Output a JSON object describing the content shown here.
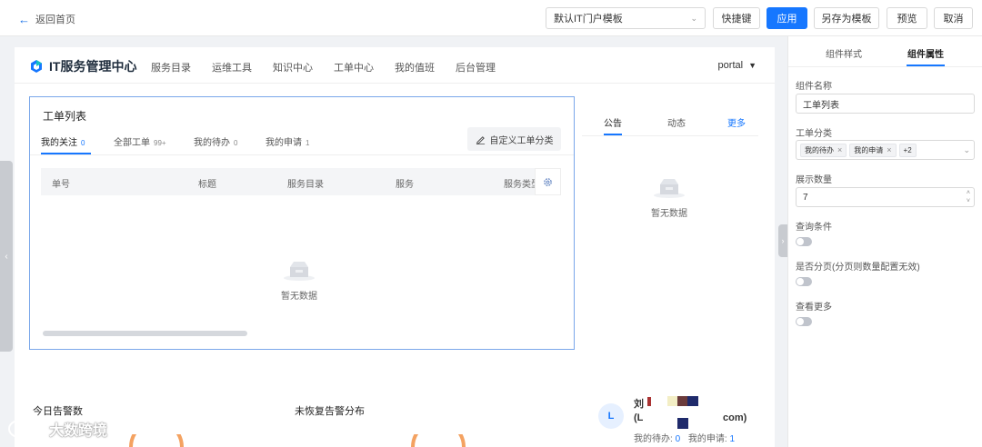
{
  "topbar": {
    "back_label": "返回首页",
    "template_select": "默认IT门户模板",
    "shortcut_label": "快捷键",
    "apply_label": "应用",
    "save_as_template_label": "另存为模板",
    "preview_label": "预览",
    "cancel_label": "取消"
  },
  "portal": {
    "title": "IT服务管理中心",
    "nav": [
      "服务目录",
      "运维工具",
      "知识中心",
      "工单中心",
      "我的值班",
      "后台管理"
    ],
    "user_label": "portal"
  },
  "ticket_list": {
    "title": "工单列表",
    "tabs": [
      {
        "label": "我的关注",
        "count": "0"
      },
      {
        "label": "全部工单",
        "count": "99+"
      },
      {
        "label": "我的待办",
        "count": "0"
      },
      {
        "label": "我的申请",
        "count": "1"
      }
    ],
    "custom_category_label": "自定义工单分类",
    "columns": [
      "单号",
      "标题",
      "服务目录",
      "服务",
      "服务类型"
    ],
    "empty_text": "暂无数据"
  },
  "notice": {
    "tabs": [
      "公告",
      "动态"
    ],
    "more_label": "更多",
    "empty_text": "暂无数据"
  },
  "bottom_cards": {
    "alarms_today_title": "今日告警数",
    "unrecovered_title": "未恢复告警分布",
    "profile": {
      "avatar_letter": "L",
      "name_fragment": "刘",
      "id_open": "(L",
      "id_close": "com)",
      "todo_label": "我的待办:",
      "todo_count": "0",
      "apply_label": "我的申请:",
      "apply_count": "1"
    }
  },
  "watermark": "大数跨境",
  "side_panel": {
    "tabs": [
      "组件样式",
      "组件属性"
    ],
    "component_name_label": "组件名称",
    "component_name_value": "工单列表",
    "ticket_category_label": "工单分类",
    "ticket_category_tags": [
      "我的待办",
      "我的申请"
    ],
    "ticket_category_more": "+2",
    "display_count_label": "展示数量",
    "display_count_value": "7",
    "query_condition_label": "查询条件",
    "pagination_label": "是否分页(分页则数量配置无效)",
    "view_more_label": "查看更多"
  },
  "colors": {
    "primary": "#1677ff",
    "selected_border": "#7aa7ea"
  }
}
